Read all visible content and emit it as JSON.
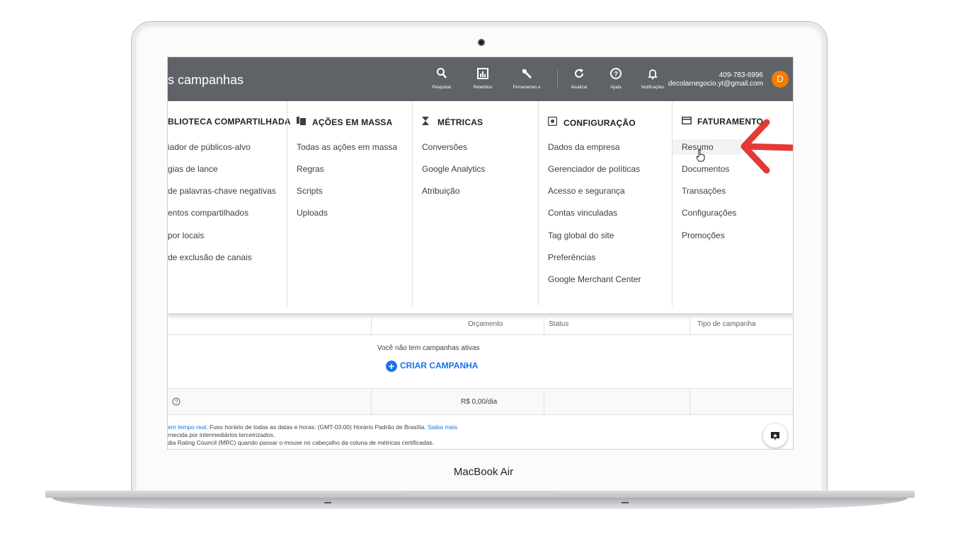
{
  "device": {
    "brand": "MacBook Air"
  },
  "header": {
    "title": "s campanhas",
    "tools": [
      {
        "icon": "search-icon",
        "glyph": "⚲",
        "label": "Pesquisar"
      },
      {
        "icon": "reports-icon",
        "glyph": "▥",
        "label": "Relatórios"
      },
      {
        "icon": "wrench-icon",
        "glyph": "✎",
        "label": "Ferramentas e"
      },
      {
        "icon": "refresh-icon",
        "glyph": "↻",
        "label": "Atualizar"
      },
      {
        "icon": "help-icon",
        "glyph": "?",
        "label": "Ajuda"
      },
      {
        "icon": "bell-icon",
        "glyph": "△",
        "label": "Notificações"
      }
    ],
    "account_id": "409-783-6996",
    "account_email": "decolarnegocio.yt@gmail.com",
    "avatar_letter": "D"
  },
  "menu": {
    "columns": [
      {
        "title": "BLIOTECA COMPARTILHADA",
        "icon": "",
        "items": [
          "iador de públicos-alvo",
          "gias de lance",
          "de palavras-chave negativas",
          "entos compartilhados",
          "por locais",
          "de exclusão de canais"
        ]
      },
      {
        "title": "AÇÕES EM MASSA",
        "icon": "bulk-actions-icon",
        "items": [
          "Todas as ações em massa",
          "Regras",
          "Scripts",
          "Uploads"
        ]
      },
      {
        "title": "MÉTRICAS",
        "icon": "hourglass-icon",
        "items": [
          "Conversões",
          "Google Analytics",
          "Atribuição"
        ]
      },
      {
        "title": "CONFIGURAÇÃO",
        "icon": "settings-icon",
        "items": [
          "Dados da empresa",
          "Gerenciador de políticas",
          "Acesso e segurança",
          "Contas vinculadas",
          "Tag global do site",
          "Preferências",
          "Google Merchant Center"
        ]
      },
      {
        "title": "FATURAMENTO",
        "icon": "credit-card-icon",
        "items": [
          "Resumo",
          "Documentos",
          "Transações",
          "Configurações",
          "Promoções"
        ]
      }
    ]
  },
  "table": {
    "headers": [
      "Orçamento",
      "Status",
      "Tipo de campanha"
    ],
    "empty_message": "Você não tem campanhas ativas",
    "create_label": "CRIAR CAMPANHA",
    "total_budget": "R$ 0,00/dia"
  },
  "footer": {
    "line1_link": "em tempo real",
    "line1_text": ". Fuso horário de todas as datas e horas: (GMT-03:00) Horário Padrão de Brasília. ",
    "line1_link2": "Saiba mais",
    "line2": "rnecida por intermediários terceirizados.",
    "line3": "dia Rating Council (MRC) quando passar o mouse no cabeçalho da coluna de métricas certificadas."
  },
  "colors": {
    "topbar": "#5f6368",
    "accent": "#1a73e8",
    "avatar": "#f57c00",
    "annotation_arrow": "#e53935"
  }
}
